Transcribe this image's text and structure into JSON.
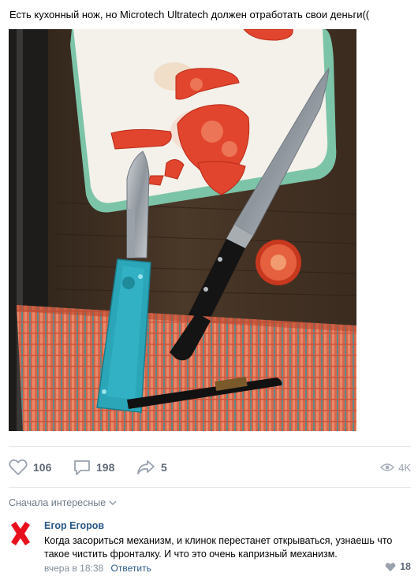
{
  "post": {
    "text": "Есть кухонный нож, но Microtech Ultratech должен отработать свои деньги(("
  },
  "actions": {
    "likes": "106",
    "comments": "198",
    "shares": "5",
    "views": "4K"
  },
  "comments": {
    "sort_label": "Сначала интересные",
    "items": [
      {
        "author": "Егор Егоров",
        "text": "Когда засориться механизм, и клинок перестанет открываться, узнаешь что такое чистить фронталку. И что это очень капризный механизм.",
        "time": "вчера в 18:38",
        "reply_label": "Ответить",
        "likes": "18"
      }
    ]
  },
  "colors": {
    "link": "#2a5885",
    "muted": "#828e99",
    "action": "#5f6a76",
    "avatar_cross": "#e8101c"
  }
}
